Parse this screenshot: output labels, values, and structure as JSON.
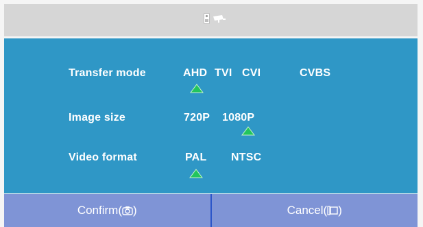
{
  "header": {
    "icons": [
      "door-station-icon",
      "camera-icon"
    ]
  },
  "settings": {
    "transfer_mode": {
      "label": "Transfer mode",
      "options": [
        "AHD",
        "TVI",
        "CVI",
        "CVBS"
      ],
      "selected": "AHD"
    },
    "image_size": {
      "label": "Image size",
      "options": [
        "720P",
        "1080P"
      ],
      "selected": "1080P"
    },
    "video_format": {
      "label": "Video format",
      "options": [
        "PAL",
        "NTSC"
      ],
      "selected": "PAL"
    }
  },
  "footer": {
    "confirm_label": "Confirm(",
    "confirm_suffix": ")",
    "cancel_label": "Cancel(",
    "cancel_suffix": ")"
  },
  "colors": {
    "panel": "#2f97c6",
    "header": "#d6d6d6",
    "footer": "#7f94d6",
    "marker": "#22c55e",
    "divider": "#2c56c9"
  }
}
